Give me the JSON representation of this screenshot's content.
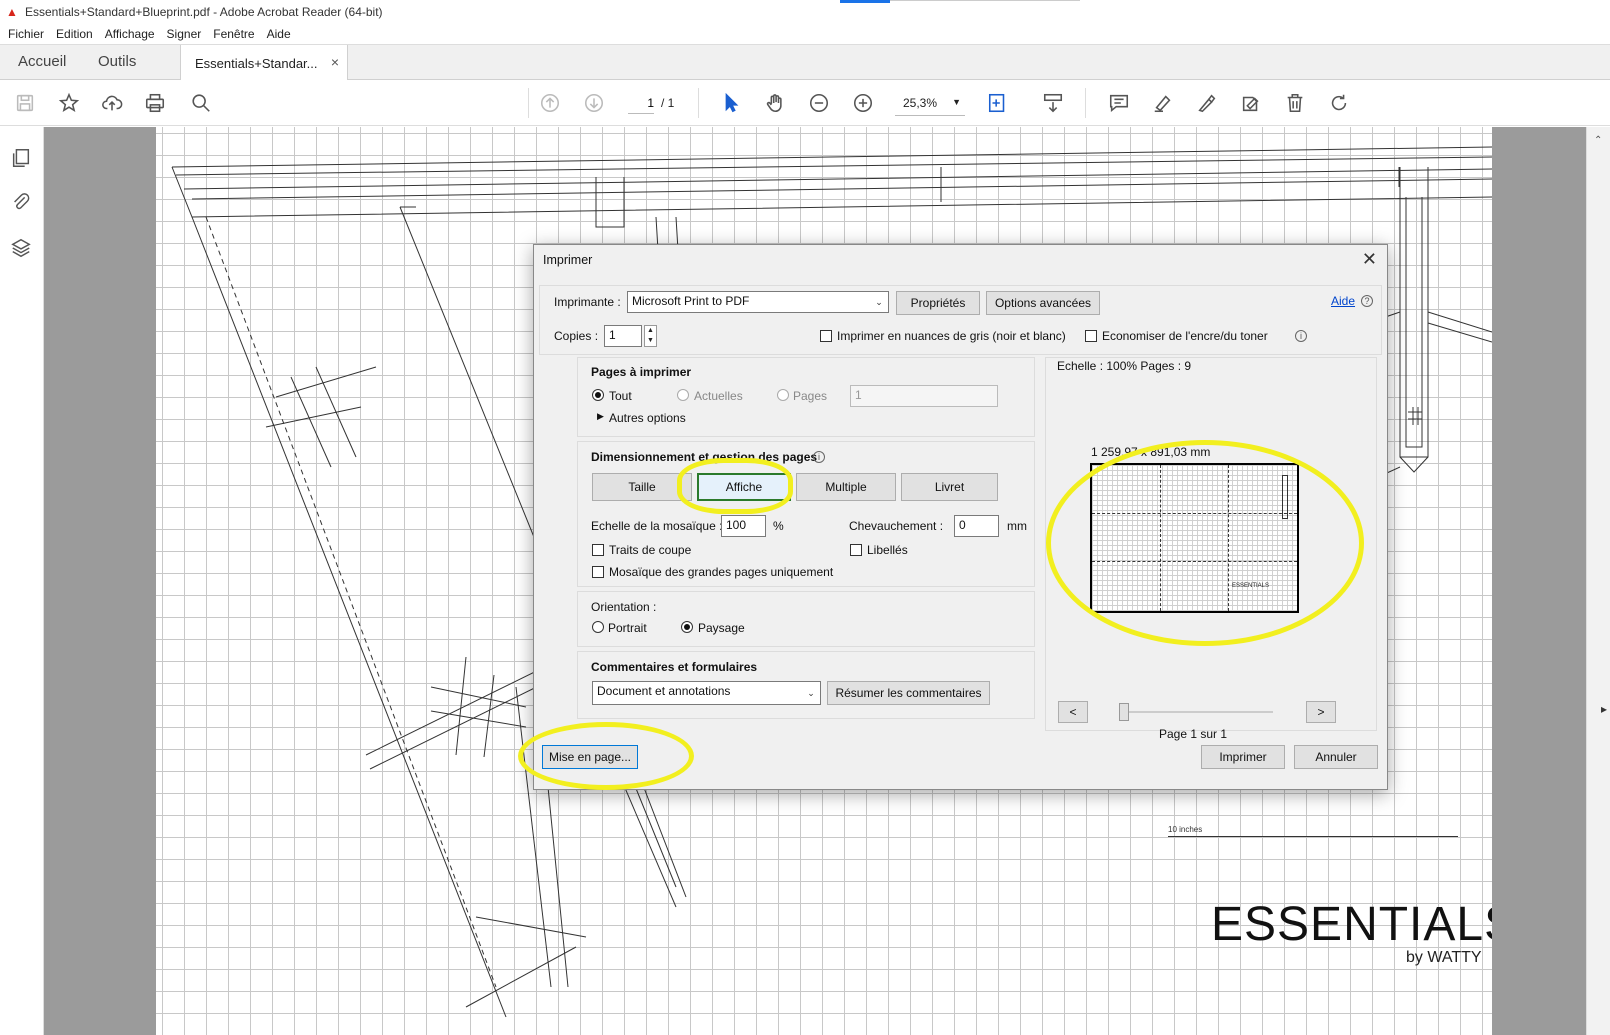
{
  "window": {
    "title": "Essentials+Standard+Blueprint.pdf - Adobe Acrobat Reader (64-bit)"
  },
  "menu": [
    "Fichier",
    "Edition",
    "Affichage",
    "Signer",
    "Fenêtre",
    "Aide"
  ],
  "tabs": {
    "home": "Accueil",
    "tools": "Outils",
    "document": "Essentials+Standar...",
    "close": "×"
  },
  "toolbar": {
    "page_current": "1",
    "page_total": "/ 1",
    "zoom": "25,3%",
    "icons": [
      "save-icon",
      "star-icon",
      "upload-icon",
      "print-icon",
      "search-zoom-icon",
      "page-up-icon",
      "page-down-icon",
      "select-arrow-icon",
      "hand-icon",
      "zoom-out-icon",
      "zoom-in-icon",
      "fit-page-icon",
      "scroll-mode-icon",
      "comment-icon",
      "highlight-icon",
      "sign-icon",
      "edit-icon",
      "delete-icon",
      "rotate-icon"
    ]
  },
  "document": {
    "brand": "ESSENTIALS",
    "brand_sub": "by WATTY",
    "scale_label": "10 inches"
  },
  "dialog": {
    "title": "Imprimer",
    "printer_label": "Imprimante :",
    "printer_value": "Microsoft Print to PDF",
    "properties_button": "Propriétés",
    "advanced_button": "Options avancées",
    "help_link": "Aide",
    "copies_label": "Copies :",
    "copies_value": "1",
    "grayscale_label": "Imprimer en nuances de gris (noir et blanc)",
    "save_ink_label": "Economiser de l'encre/du toner",
    "pages_section": {
      "title": "Pages à imprimer",
      "all": "Tout",
      "current": "Actuelles",
      "pages": "Pages",
      "pages_value": "1",
      "more": "Autres options"
    },
    "sizing_section": {
      "title": "Dimensionnement et gestion des pages",
      "buttons": [
        "Taille",
        "Affiche",
        "Multiple",
        "Livret"
      ],
      "selected": "Affiche",
      "tile_scale_label": "Echelle de la mosaïque :",
      "tile_scale_value": "100",
      "tile_scale_unit": "%",
      "overlap_label": "Chevauchement :",
      "overlap_value": "0",
      "overlap_unit": "mm",
      "cut_marks": "Traits de coupe",
      "labels": "Libellés",
      "tile_large_only": "Mosaïque des grandes pages uniquement"
    },
    "orientation_section": {
      "title": "Orientation :",
      "portrait": "Portrait",
      "landscape": "Paysage",
      "selected": "Paysage"
    },
    "comments_section": {
      "title": "Commentaires et formulaires",
      "value": "Document et annotations",
      "summarize_button": "Résumer les commentaires"
    },
    "preview": {
      "scale_info": "Echelle : 100% Pages : 9",
      "dimensions": "1 259,97 x 891,03 mm",
      "prev": "<",
      "next": ">",
      "page_info": "Page 1 sur 1",
      "mini_brand": "ESSENTIALS"
    },
    "page_setup_button": "Mise en page...",
    "print_button": "Imprimer",
    "cancel_button": "Annuler"
  },
  "colors": {
    "highlight": "#f2ef1f",
    "selected_border": "#2b7a2b",
    "link": "#0044cc"
  }
}
